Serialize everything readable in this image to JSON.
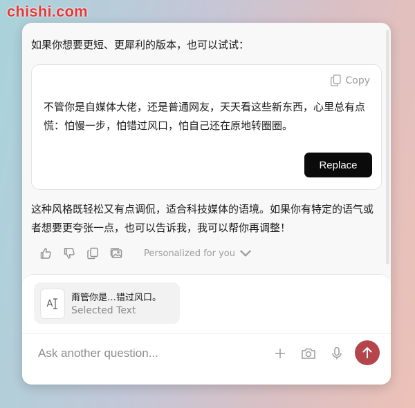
{
  "watermark": "chishi.com",
  "intro_text": "如果你想要更短、更犀利的版本，也可以试试：",
  "card": {
    "copy_label": "Copy",
    "text": "不管你是自媒体大佬，还是普通网友，天天看这些新东西，心里总有点慌：怕慢一步，怕错过风口，怕自己还在原地转圈圈。",
    "replace_label": "Replace"
  },
  "outro_text": "这种风格既轻松又有点调侃，适合科技媒体的语境。如果你有特定的语气或者想要更夸张一点，也可以告诉我，我可以帮你再调整！",
  "actions": {
    "icons": [
      "thumbs-up-icon",
      "thumbs-down-icon",
      "copy-icon",
      "images-icon"
    ],
    "personalized_label": "Personalized for you"
  },
  "composer": {
    "chip_title": "甭管你是…错过风口。",
    "chip_subtitle": "Selected Text",
    "chip_icon_text": "A",
    "placeholder": "Ask another question...",
    "tools": [
      "plus-icon",
      "camera-icon",
      "microphone-icon"
    ],
    "send_color": "#b5454d"
  },
  "colors": {
    "accent": "#b5454d",
    "button_dark": "#0b0b0b",
    "watermark_red": "#e23a3a"
  }
}
